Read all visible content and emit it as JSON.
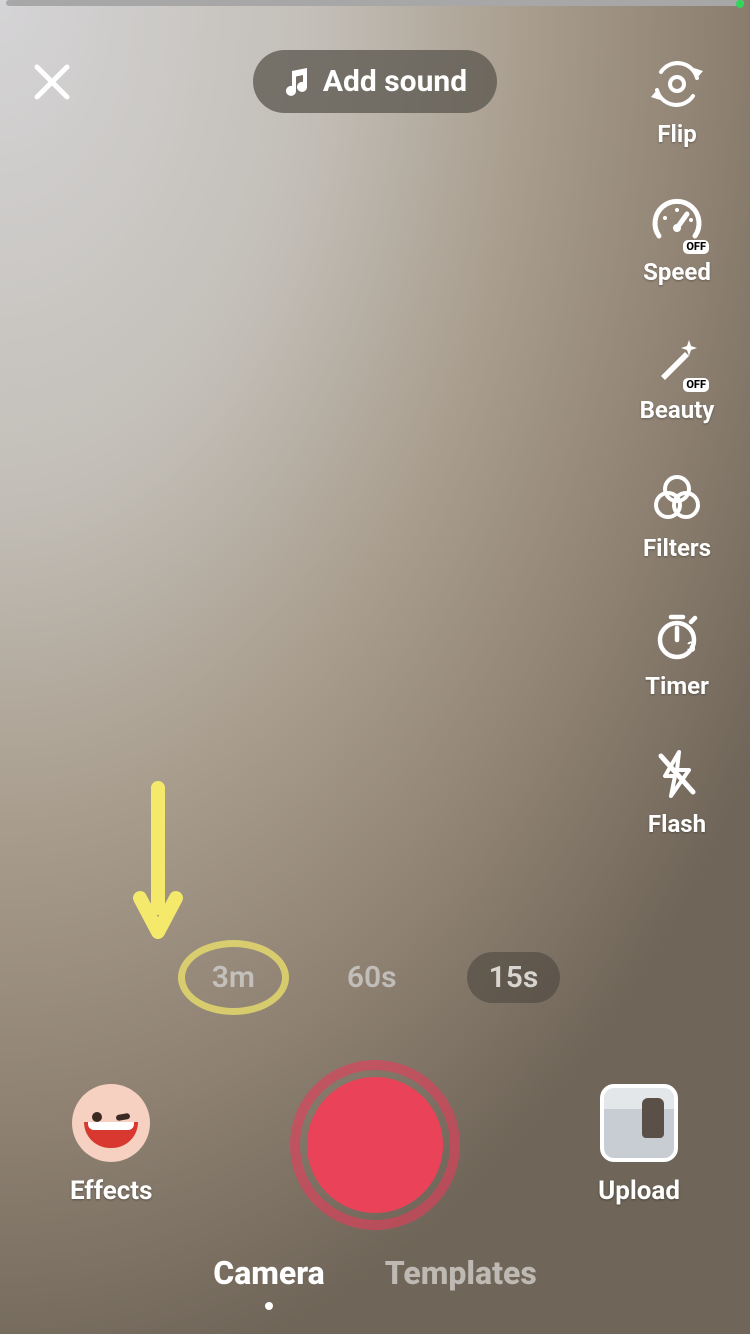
{
  "header": {
    "add_sound_label": "Add sound"
  },
  "side_tools": [
    {
      "name": "flip",
      "label": "Flip",
      "badge": null
    },
    {
      "name": "speed",
      "label": "Speed",
      "badge": "OFF"
    },
    {
      "name": "beauty",
      "label": "Beauty",
      "badge": "OFF"
    },
    {
      "name": "filters",
      "label": "Filters",
      "badge": null
    },
    {
      "name": "timer",
      "label": "Timer",
      "badge": null
    },
    {
      "name": "flash",
      "label": "Flash",
      "badge": null
    }
  ],
  "durations": {
    "options": [
      "3m",
      "60s",
      "15s"
    ],
    "selected": "15s",
    "annotated": "3m"
  },
  "bottom": {
    "effects_label": "Effects",
    "upload_label": "Upload"
  },
  "modes": {
    "options": [
      "Camera",
      "Templates"
    ],
    "active": "Camera"
  },
  "colors": {
    "record": "#ea4359",
    "annotation": "#f4e96a"
  }
}
